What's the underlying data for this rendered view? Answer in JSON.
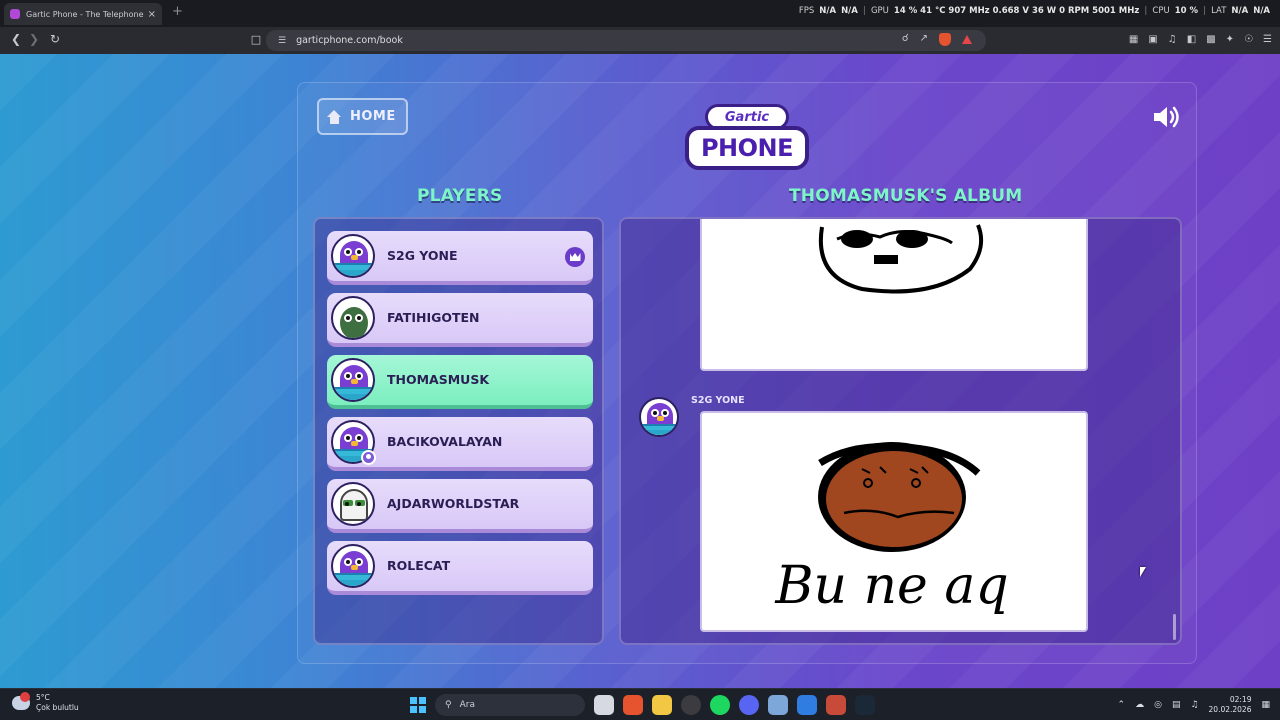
{
  "browser": {
    "tab_title": "Gartic Phone - The Telephone Ga",
    "tab_close": "×",
    "new_tab": "+",
    "url": "garticphone.com/book",
    "overlay": {
      "fps_label": "FPS",
      "fps1": "N/A",
      "fps2": "N/A",
      "gpu_label": "GPU",
      "gpu_stats": "14 % 41 °C 907 MHz 0.668 V 36 W 0 RPM 5001 MHz",
      "cpu_label": "CPU",
      "cpu_value": "10 %",
      "lat_label": "LAT",
      "lat1": "N/A",
      "lat2": "N/A"
    }
  },
  "game": {
    "home_label": "HOME",
    "logo_top": "Gartic",
    "logo_bottom": "PHONE",
    "players_title": "PLAYERS",
    "album_title": "THOMASMUSK'S ALBUM",
    "players": [
      {
        "name": "S2G YONE",
        "host": true,
        "active": false,
        "avatar": "purple-bird"
      },
      {
        "name": "FATIHIGOTEN",
        "host": false,
        "active": false,
        "avatar": "green-bomb"
      },
      {
        "name": "THOMASMUSK",
        "host": false,
        "active": true,
        "avatar": "purple-bird"
      },
      {
        "name": "BACIKOVALAYAN",
        "host": false,
        "active": false,
        "avatar": "purple-bird"
      },
      {
        "name": "AJDARWORLDSTAR",
        "host": false,
        "active": false,
        "avatar": "white-sunglasses"
      },
      {
        "name": "ROLECAT",
        "host": false,
        "active": false,
        "avatar": "purple-bird"
      }
    ],
    "album": {
      "message_author": "S2G YONE",
      "drawing_text": "Bu ne aq"
    }
  },
  "taskbar": {
    "temp": "5°C",
    "weather": "Çok bulutlu",
    "search_placeholder": "Ara",
    "time": "02:19",
    "date": "20.02.2026"
  },
  "colors": {
    "accent_green": "#7df5c8",
    "player_active": "#7ceebf",
    "player_card": "#e7dcfb",
    "brand_purple": "#5b2ec2"
  }
}
